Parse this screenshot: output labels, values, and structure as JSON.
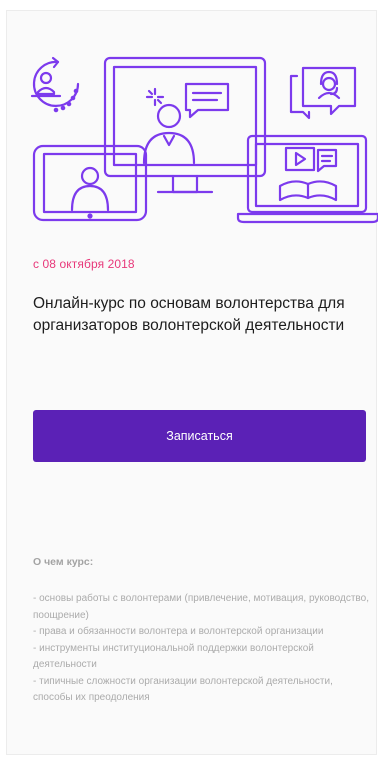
{
  "course": {
    "date": "с 08 октября 2018",
    "title": "Онлайн-курс по основам волонтерства для организаторов волонтерской деятельности",
    "signup_label": "Записаться",
    "about": {
      "heading": "О чем курс:",
      "items": [
        "- основы работы с волонтерами (привлечение, мотивация, руководство, поощрение)",
        "- права и обязанности волонтера и волонтерской организации",
        "- инструменты институциональной поддержки волонтерской деятельности",
        "- типичные сложности организации волонтерской деятельности, способы их преодоления"
      ]
    }
  },
  "colors": {
    "accent": "#5b21b6",
    "illustration": "#7c3aed",
    "date": "#e8387a",
    "muted_text": "#ababab"
  },
  "icons": {
    "illustration": [
      "monitor-icon",
      "person-icon",
      "tablet-icon",
      "laptop-icon",
      "video-play-icon",
      "book-icon",
      "speech-bubble-icon",
      "headset-icon",
      "refresh-user-icon"
    ]
  }
}
